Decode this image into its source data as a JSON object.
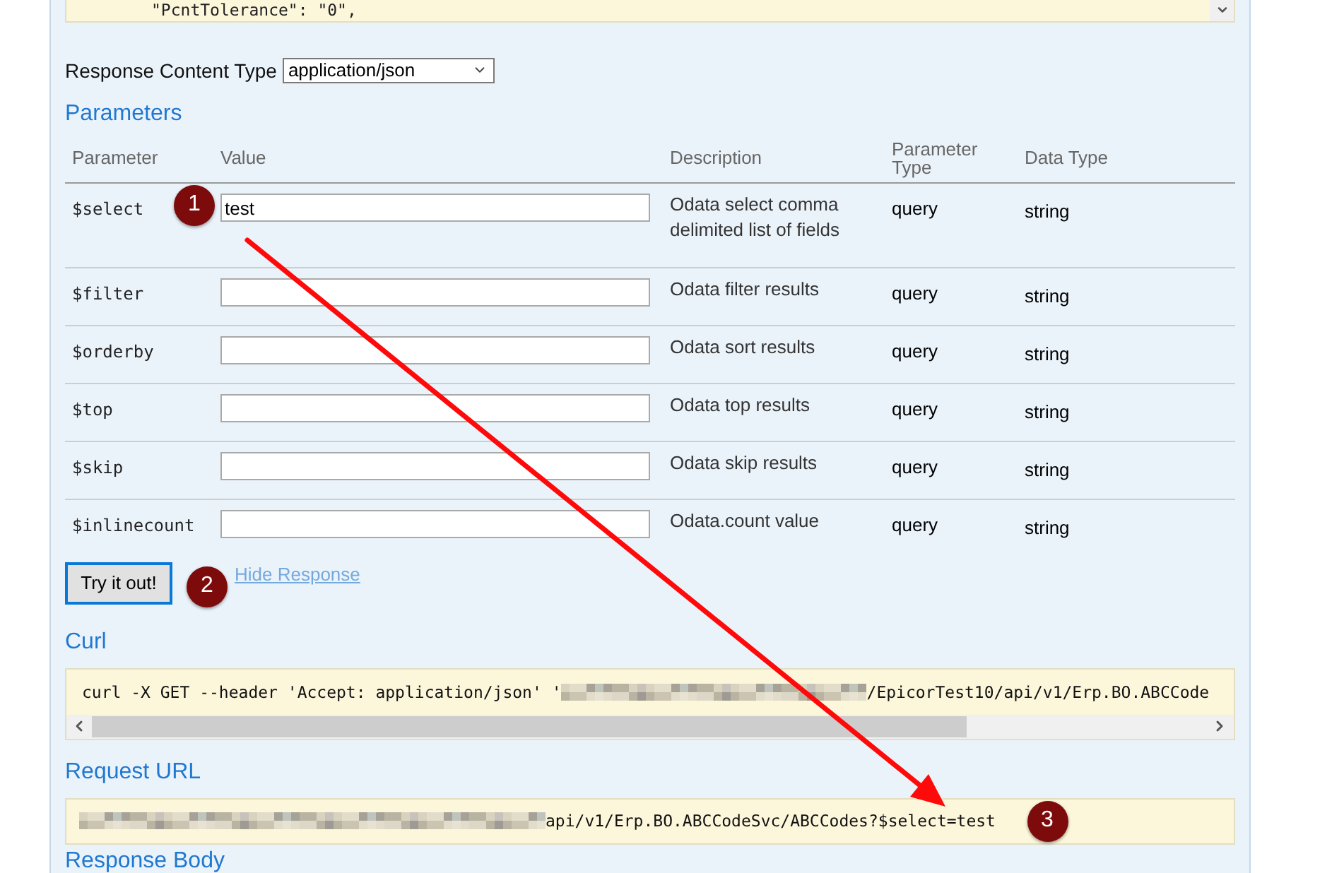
{
  "code_block": {
    "lines": [
      "\"PcntTolerance\": \"0\","
    ]
  },
  "response_content_type": {
    "label": "Response Content Type",
    "value": "application/json"
  },
  "parameters": {
    "title": "Parameters",
    "columns": [
      "Parameter",
      "Value",
      "Description",
      "Parameter Type",
      "Data Type"
    ],
    "rows": [
      {
        "name": "$select",
        "value": "test",
        "description": "Odata select comma delimited list of fields",
        "parameter_type": "query",
        "data_type": "string"
      },
      {
        "name": "$filter",
        "description": "Odata filter results",
        "parameter_type": "query",
        "data_type": "string"
      },
      {
        "name": "$orderby",
        "description": "Odata sort results",
        "parameter_type": "query",
        "data_type": "string"
      },
      {
        "name": "$top",
        "description": "Odata top results",
        "parameter_type": "query",
        "data_type": "string"
      },
      {
        "name": "$skip",
        "description": "Odata skip results",
        "parameter_type": "query",
        "data_type": "string"
      },
      {
        "name": "$inlinecount",
        "description": "Odata.count value",
        "parameter_type": "query",
        "data_type": "string"
      }
    ]
  },
  "try_button": "Try it out!",
  "hide_response_link": "Hide Response",
  "curl": {
    "title": "Curl",
    "command_start": "curl -X GET --header 'Accept: application/json' '",
    "command_end": "/EpicorTest10/api/v1/Erp.BO.ABCCode"
  },
  "request_url": {
    "title": "Request URL",
    "url_end": "api/v1/Erp.BO.ABCCodeSvc/ABCCodes?$select=test"
  },
  "response_body": {
    "title": "Response Body"
  },
  "annotations": [
    {
      "label": "1"
    },
    {
      "label": "2"
    },
    {
      "label": "3"
    }
  ]
}
